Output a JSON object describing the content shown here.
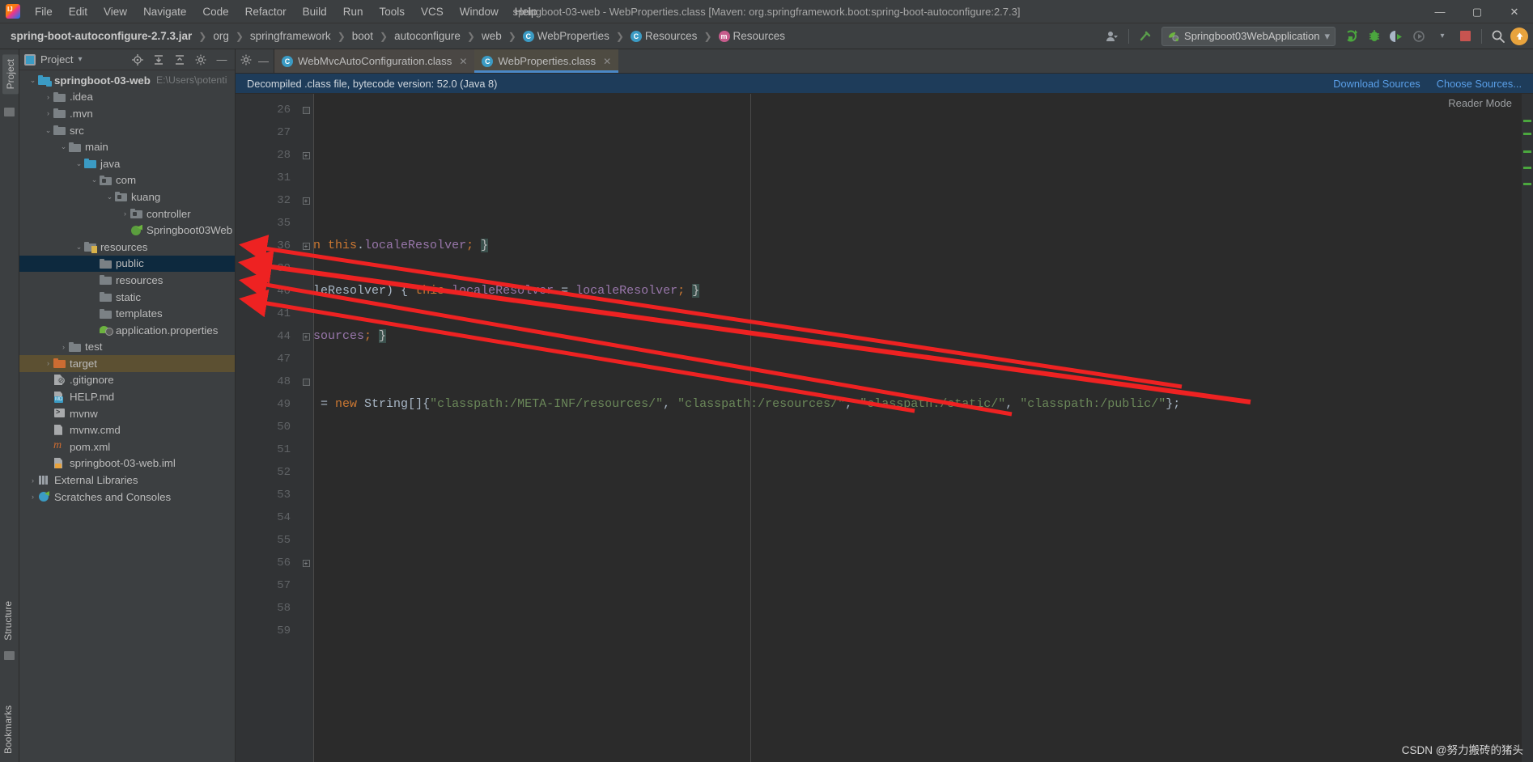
{
  "window": {
    "title": "springboot-03-web - WebProperties.class [Maven: org.springframework.boot:spring-boot-autoconfigure:2.7.3]",
    "minimize": "—",
    "maximize": "▢",
    "close": "✕"
  },
  "menu": {
    "items": [
      "File",
      "Edit",
      "View",
      "Navigate",
      "Code",
      "Refactor",
      "Build",
      "Run",
      "Tools",
      "VCS",
      "Window",
      "Help"
    ]
  },
  "breadcrumbs": {
    "items": [
      {
        "label": "spring-boot-autoconfigure-2.7.3.jar",
        "icon": "",
        "bold": true
      },
      {
        "label": "org",
        "icon": ""
      },
      {
        "label": "springframework",
        "icon": ""
      },
      {
        "label": "boot",
        "icon": ""
      },
      {
        "label": "autoconfigure",
        "icon": ""
      },
      {
        "label": "web",
        "icon": ""
      },
      {
        "label": "WebProperties",
        "icon": "class-icon"
      },
      {
        "label": "Resources",
        "icon": "class-icon"
      },
      {
        "label": "Resources",
        "icon": "method-icon"
      }
    ],
    "separator": "❯"
  },
  "toolbar": {
    "profile_icon": "user-icon",
    "updates_icon": "arrow-up-icon",
    "run_config": "Springboot03WebApplication",
    "run_config_icon": "spring-leaf-icon",
    "dropdown_caret": "▾",
    "buttons": [
      {
        "name": "run-button",
        "glyph": "▶"
      },
      {
        "name": "debug-button",
        "glyph": "🐞"
      },
      {
        "name": "run-with-coverage-button",
        "glyph": "▶"
      },
      {
        "name": "profiler-button",
        "glyph": "◔"
      },
      {
        "name": "stop-button",
        "glyph": "■"
      },
      {
        "name": "search-everywhere-button",
        "glyph": "🔍"
      }
    ]
  },
  "sidebar": {
    "title": "Project",
    "caret": "▾",
    "tools": [
      "locate-icon",
      "expand-all-icon",
      "collapse-all-icon",
      "settings-icon",
      "hide-icon"
    ],
    "left_strip": [
      "Project",
      "Structure",
      "Bookmarks"
    ],
    "tree": [
      {
        "depth": 0,
        "arrow": "⌄",
        "icon": "module-folder",
        "label": "springboot-03-web",
        "bold": true,
        "path": "E:\\Users\\potenti",
        "state": "normal"
      },
      {
        "depth": 1,
        "arrow": "›",
        "icon": "folder",
        "label": ".idea",
        "state": "normal"
      },
      {
        "depth": 1,
        "arrow": "›",
        "icon": "folder",
        "label": ".mvn",
        "state": "normal"
      },
      {
        "depth": 1,
        "arrow": "⌄",
        "icon": "folder",
        "label": "src",
        "state": "normal"
      },
      {
        "depth": 2,
        "arrow": "⌄",
        "icon": "folder",
        "label": "main",
        "state": "normal"
      },
      {
        "depth": 3,
        "arrow": "⌄",
        "icon": "source-folder",
        "label": "java",
        "state": "normal"
      },
      {
        "depth": 4,
        "arrow": "⌄",
        "icon": "package-folder",
        "label": "com",
        "state": "normal"
      },
      {
        "depth": 5,
        "arrow": "⌄",
        "icon": "package-folder",
        "label": "kuang",
        "state": "normal"
      },
      {
        "depth": 6,
        "arrow": "›",
        "icon": "package-folder",
        "label": "controller",
        "state": "normal"
      },
      {
        "depth": 6,
        "arrow": "",
        "icon": "spring-class",
        "label": "Springboot03Web",
        "state": "normal"
      },
      {
        "depth": 3,
        "arrow": "⌄",
        "icon": "resource-folder",
        "label": "resources",
        "state": "normal"
      },
      {
        "depth": 4,
        "arrow": "",
        "icon": "folder",
        "label": "public",
        "state": "selected"
      },
      {
        "depth": 4,
        "arrow": "",
        "icon": "folder",
        "label": "resources",
        "state": "normal"
      },
      {
        "depth": 4,
        "arrow": "",
        "icon": "folder",
        "label": "static",
        "state": "normal"
      },
      {
        "depth": 4,
        "arrow": "",
        "icon": "folder",
        "label": "templates",
        "state": "normal"
      },
      {
        "depth": 4,
        "arrow": "",
        "icon": "properties-file",
        "label": "application.properties",
        "state": "normal"
      },
      {
        "depth": 2,
        "arrow": "›",
        "icon": "folder",
        "label": "test",
        "state": "normal"
      },
      {
        "depth": 1,
        "arrow": "›",
        "icon": "target-folder",
        "label": "target",
        "state": "highlighted"
      },
      {
        "depth": 1,
        "arrow": "",
        "icon": "gitignore-file",
        "label": ".gitignore",
        "state": "normal"
      },
      {
        "depth": 1,
        "arrow": "",
        "icon": "markdown-file",
        "label": "HELP.md",
        "state": "normal"
      },
      {
        "depth": 1,
        "arrow": "",
        "icon": "shell-file",
        "label": "mvnw",
        "state": "normal"
      },
      {
        "depth": 1,
        "arrow": "",
        "icon": "cmd-file",
        "label": "mvnw.cmd",
        "state": "normal"
      },
      {
        "depth": 1,
        "arrow": "",
        "icon": "maven-file",
        "label": "pom.xml",
        "state": "normal"
      },
      {
        "depth": 1,
        "arrow": "",
        "icon": "iml-file",
        "label": "springboot-03-web.iml",
        "state": "normal"
      },
      {
        "depth": 0,
        "arrow": "›",
        "icon": "library-icon",
        "label": "External Libraries",
        "state": "normal"
      },
      {
        "depth": 0,
        "arrow": "›",
        "icon": "scratch-icon",
        "label": "Scratches and Consoles",
        "state": "normal"
      }
    ]
  },
  "editor": {
    "tabs": [
      {
        "label": "WebMvcAutoConfiguration.class",
        "icon": "class-icon",
        "close": "✕",
        "active": false
      },
      {
        "label": "WebProperties.class",
        "icon": "class-icon",
        "close": "✕",
        "active": true
      }
    ],
    "tab_tools": [
      "settings-icon",
      "hide-icon"
    ],
    "banner": {
      "text": "Decompiled .class file, bytecode version: 52.0 (Java 8)",
      "download_sources": "Download Sources",
      "choose_sources": "Choose Sources..."
    },
    "reader_mode": "Reader Mode",
    "line_numbers": [
      "26",
      "27",
      "28",
      "31",
      "32",
      "35",
      "36",
      "39",
      "40",
      "41",
      "44",
      "47",
      "48",
      "49",
      "50",
      "51",
      "52",
      "53",
      "54",
      "55",
      "56",
      "57",
      "58",
      "59"
    ],
    "lines": [
      {
        "num": "26",
        "fold": "folded",
        "tokens": []
      },
      {
        "num": "27",
        "fold": "",
        "tokens": []
      },
      {
        "num": "28",
        "fold": "plus",
        "tokens": []
      },
      {
        "num": "31",
        "fold": "",
        "tokens": []
      },
      {
        "num": "32",
        "fold": "plus",
        "tokens": []
      },
      {
        "num": "35",
        "fold": "",
        "tokens": []
      },
      {
        "num": "36",
        "fold": "plus",
        "tokens": [
          {
            "t": "n ",
            "c": "k"
          },
          {
            "t": "this",
            "c": "k"
          },
          {
            "t": ".",
            "c": "p"
          },
          {
            "t": "localeResolver",
            "c": "f"
          },
          {
            "t": ";",
            "c": "orange"
          },
          {
            "t": " ",
            "c": "p"
          },
          {
            "t": "}",
            "c": "hl"
          }
        ]
      },
      {
        "num": "39",
        "fold": "",
        "tokens": []
      },
      {
        "num": "40",
        "fold": "",
        "tokens": [
          {
            "t": "leResolver)",
            "c": "p"
          },
          {
            "t": " {",
            "c": "p"
          },
          {
            "t": " ",
            "c": "p"
          },
          {
            "t": "this",
            "c": "k"
          },
          {
            "t": ".",
            "c": "p"
          },
          {
            "t": "localeResolver",
            "c": "f"
          },
          {
            "t": " = ",
            "c": "p"
          },
          {
            "t": "localeResolver",
            "c": "f"
          },
          {
            "t": ";",
            "c": "orange"
          },
          {
            "t": " ",
            "c": "p"
          },
          {
            "t": "}",
            "c": "hl"
          }
        ]
      },
      {
        "num": "41",
        "fold": "",
        "tokens": []
      },
      {
        "num": "44",
        "fold": "plus",
        "tokens": [
          {
            "t": "sources",
            "c": "f"
          },
          {
            "t": ";",
            "c": "orange"
          },
          {
            "t": " ",
            "c": "p"
          },
          {
            "t": "}",
            "c": "hl"
          }
        ]
      },
      {
        "num": "47",
        "fold": "",
        "tokens": []
      },
      {
        "num": "48",
        "fold": "folded",
        "tokens": []
      },
      {
        "num": "49",
        "fold": "",
        "tokens": [
          {
            "t": " = ",
            "c": "p"
          },
          {
            "t": "new",
            "c": "k"
          },
          {
            "t": " ",
            "c": "p"
          },
          {
            "t": "String",
            "c": "t"
          },
          {
            "t": "[]{",
            "c": "p"
          },
          {
            "t": "\"classpath:/META-INF/resources/\"",
            "c": "s"
          },
          {
            "t": ", ",
            "c": "p"
          },
          {
            "t": "\"classpath:/resources/\"",
            "c": "s"
          },
          {
            "t": ", ",
            "c": "p"
          },
          {
            "t": "\"classpath:/static/\"",
            "c": "s"
          },
          {
            "t": ", ",
            "c": "p"
          },
          {
            "t": "\"classpath:/public/\"",
            "c": "s"
          },
          {
            "t": "};",
            "c": "p"
          }
        ]
      },
      {
        "num": "50",
        "fold": "",
        "tokens": []
      },
      {
        "num": "51",
        "fold": "",
        "tokens": []
      },
      {
        "num": "52",
        "fold": "",
        "tokens": []
      },
      {
        "num": "53",
        "fold": "",
        "tokens": []
      },
      {
        "num": "54",
        "fold": "",
        "tokens": []
      },
      {
        "num": "55",
        "fold": "",
        "tokens": []
      },
      {
        "num": "56",
        "fold": "plus",
        "tokens": []
      },
      {
        "num": "57",
        "fold": "",
        "tokens": []
      },
      {
        "num": "58",
        "fold": "",
        "tokens": []
      },
      {
        "num": "59",
        "fold": "",
        "tokens": []
      }
    ]
  },
  "watermark": "CSDN @努力搬砖的猪头",
  "colors": {
    "accent_blue": "#4a88c7",
    "annotation_red": "#ee2222",
    "selection": "#0d293e",
    "target_highlight": "#5c5032",
    "string_green": "#6a8759",
    "keyword_orange": "#cc7832",
    "field_purple": "#9876aa"
  }
}
